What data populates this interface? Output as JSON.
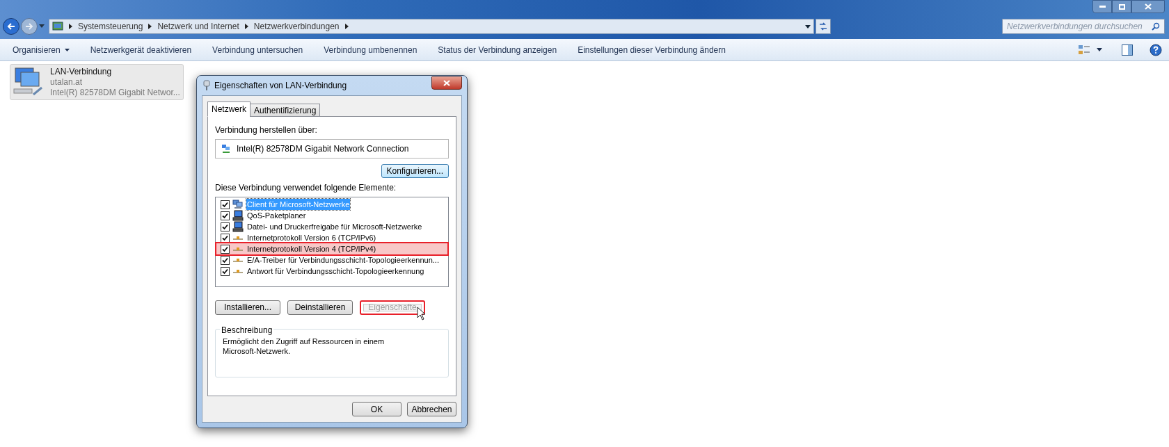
{
  "explorer": {
    "breadcrumb": [
      "Systemsteuerung",
      "Netzwerk und Internet",
      "Netzwerkverbindungen"
    ],
    "search": {
      "placeholder": "Netzwerkverbindungen durchsuchen"
    },
    "toolbar": [
      "Organisieren",
      "Netzwerkgerät deaktivieren",
      "Verbindung untersuchen",
      "Verbindung umbenennen",
      "Status der Verbindung anzeigen",
      "Einstellungen dieser Verbindung ändern"
    ],
    "connection": {
      "name": "LAN-Verbindung",
      "network": "utalan.at",
      "adapter": "Intel(R) 82578DM Gigabit Networ...",
      "selected": true
    }
  },
  "dialog": {
    "title": "Eigenschaften von LAN-Verbindung",
    "tabs": [
      {
        "label": "Netzwerk",
        "selected": true
      },
      {
        "label": "Authentifizierung",
        "selected": false
      }
    ],
    "connect_label": "Verbindung herstellen über:",
    "adapter": "Intel(R) 82578DM Gigabit Network Connection",
    "configure_button": "Konfigurieren...",
    "items_label": "Diese Verbindung verwendet folgende Elemente:",
    "items": [
      {
        "kind": "client",
        "label": "Client für Microsoft-Netzwerke",
        "checked": true,
        "selected": true,
        "highlighted": false
      },
      {
        "kind": "service",
        "label": "QoS-Paketplaner",
        "checked": true,
        "selected": false,
        "highlighted": false
      },
      {
        "kind": "service",
        "label": "Datei- und Druckerfreigabe für Microsoft-Netzwerke",
        "checked": true,
        "selected": false,
        "highlighted": false
      },
      {
        "kind": "protocol",
        "label": "Internetprotokoll Version 6 (TCP/IPv6)",
        "checked": true,
        "selected": false,
        "highlighted": false
      },
      {
        "kind": "protocol",
        "label": "Internetprotokoll Version 4 (TCP/IPv4)",
        "checked": true,
        "selected": false,
        "highlighted": true
      },
      {
        "kind": "protocol",
        "label": "E/A-Treiber für Verbindungsschicht-Topologieerkennun...",
        "checked": true,
        "selected": false,
        "highlighted": false
      },
      {
        "kind": "protocol",
        "label": "Antwort für Verbindungsschicht-Topologieerkennung",
        "checked": true,
        "selected": false,
        "highlighted": false
      }
    ],
    "item_buttons": [
      {
        "label": "Installieren...",
        "disabled": false,
        "highlighted": false
      },
      {
        "label": "Deinstallieren",
        "disabled": false,
        "highlighted": false
      },
      {
        "label": "Eigenschafte",
        "disabled": true,
        "highlighted": true
      }
    ],
    "description_title": "Beschreibung",
    "description": "Ermöglicht den Zugriff auf Ressourcen in einem Microsoft-Netzwerk.",
    "buttons": [
      "OK",
      "Abbrechen"
    ]
  }
}
